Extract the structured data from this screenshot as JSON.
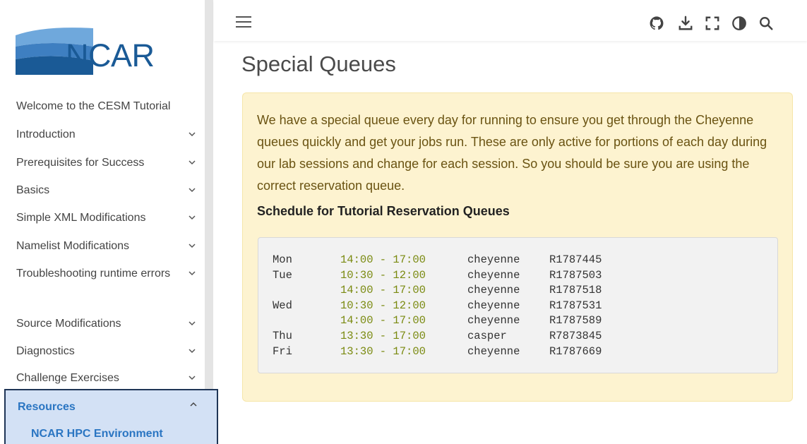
{
  "sidebar": {
    "logo_text": "NCAR",
    "items": [
      {
        "label": "Welcome to the CESM Tutorial",
        "has_chevron": false
      },
      {
        "label": "Introduction",
        "has_chevron": true
      },
      {
        "label": "Prerequisites for Success",
        "has_chevron": true
      },
      {
        "label": "Basics",
        "has_chevron": true
      },
      {
        "label": "Simple XML Modifications",
        "has_chevron": true
      },
      {
        "label": "Namelist Modifications",
        "has_chevron": true
      },
      {
        "label": "Troubleshooting runtime errors",
        "has_chevron": true
      },
      {
        "label": "Source Modifications",
        "has_chevron": true
      },
      {
        "label": "Diagnostics",
        "has_chevron": true
      },
      {
        "label": "Challenge Exercises",
        "has_chevron": true
      }
    ],
    "active_section": {
      "label": "Resources",
      "expanded": true,
      "sub_item": "NCAR HPC Environment"
    }
  },
  "header": {
    "icons": [
      "menu-icon",
      "github-icon",
      "download-icon",
      "fullscreen-icon",
      "theme-toggle-icon",
      "search-icon"
    ]
  },
  "main": {
    "title": "Special Queues",
    "callout": {
      "text": "We have a special queue every day for running to ensure you get through the Cheyenne queues quickly and get your jobs run. These are only active for portions of each day during our lab sessions and change for each session. So you should be sure you are using the correct reservation queue.",
      "subheading": "Schedule for Tutorial Reservation Queues"
    },
    "schedule": [
      {
        "day": "Mon",
        "time": "14:00 - 17:00",
        "machine": "cheyenne",
        "reservation": "R1787445"
      },
      {
        "day": "Tue",
        "time": "10:30 - 12:00",
        "machine": "cheyenne",
        "reservation": "R1787503"
      },
      {
        "day": "",
        "time": "14:00 - 17:00",
        "machine": "cheyenne",
        "reservation": "R1787518"
      },
      {
        "day": "Wed",
        "time": "10:30 - 12:00",
        "machine": "cheyenne",
        "reservation": "R1787531"
      },
      {
        "day": "",
        "time": "14:00 - 17:00",
        "machine": "cheyenne",
        "reservation": "R1787589"
      },
      {
        "day": "Thu",
        "time": "13:30 - 17:00",
        "machine": "casper",
        "reservation": "R7873845"
      },
      {
        "day": "Fri",
        "time": "13:30 - 17:00",
        "machine": "cheyenne",
        "reservation": "R1787669"
      }
    ]
  },
  "colors": {
    "accent": "#2a75c2",
    "callout_bg": "#fdf3d0",
    "callout_text": "#6a5312",
    "time_text": "#7a8a10",
    "active_bg": "#d3e1f5",
    "logo_blue": "#1a5a96"
  }
}
